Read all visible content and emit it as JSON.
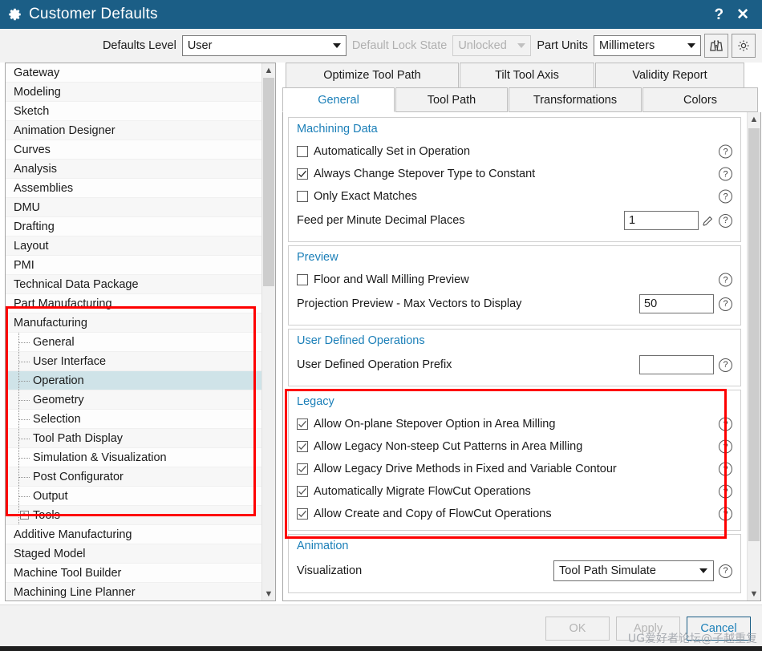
{
  "window": {
    "title": "Customer Defaults",
    "icon": "gear-icon",
    "help_button": "?",
    "close_button": "✕"
  },
  "toolbar": {
    "defaults_level_label": "Defaults Level",
    "defaults_level_value": "User",
    "lock_state_label": "Default Lock State",
    "lock_state_value": "Unlocked",
    "part_units_label": "Part Units",
    "part_units_value": "Millimeters",
    "find_icon": "binoculars-icon",
    "settings_icon": "gear-icon"
  },
  "sidebar": {
    "items": [
      {
        "label": "Gateway",
        "level": 0
      },
      {
        "label": "Modeling",
        "level": 0
      },
      {
        "label": "Sketch",
        "level": 0
      },
      {
        "label": "Animation Designer",
        "level": 0
      },
      {
        "label": "Curves",
        "level": 0
      },
      {
        "label": "Analysis",
        "level": 0
      },
      {
        "label": "Assemblies",
        "level": 0
      },
      {
        "label": "DMU",
        "level": 0
      },
      {
        "label": "Drafting",
        "level": 0
      },
      {
        "label": "Layout",
        "level": 0
      },
      {
        "label": "PMI",
        "level": 0
      },
      {
        "label": "Technical Data Package",
        "level": 0
      },
      {
        "label": "Part Manufacturing",
        "level": 0
      },
      {
        "label": "Manufacturing",
        "level": 0
      },
      {
        "label": "General",
        "level": 1
      },
      {
        "label": "User Interface",
        "level": 1
      },
      {
        "label": "Operation",
        "level": 1,
        "selected": true
      },
      {
        "label": "Geometry",
        "level": 1
      },
      {
        "label": "Selection",
        "level": 1
      },
      {
        "label": "Tool Path Display",
        "level": 1
      },
      {
        "label": "Simulation & Visualization",
        "level": 1
      },
      {
        "label": "Post Configurator",
        "level": 1
      },
      {
        "label": "Output",
        "level": 1
      },
      {
        "label": "Tools",
        "level": 1,
        "expandable": true,
        "expander": "+"
      },
      {
        "label": "Additive Manufacturing",
        "level": 0
      },
      {
        "label": "Staged Model",
        "level": 0
      },
      {
        "label": "Machine Tool Builder",
        "level": 0
      },
      {
        "label": "Machining Line Planner",
        "level": 0
      }
    ]
  },
  "tabs_top": [
    {
      "label": "Optimize Tool Path"
    },
    {
      "label": "Tilt Tool Axis"
    },
    {
      "label": "Validity Report"
    }
  ],
  "tabs_bottom": [
    {
      "label": "General",
      "active": true
    },
    {
      "label": "Tool Path"
    },
    {
      "label": "Transformations"
    },
    {
      "label": "Colors"
    }
  ],
  "panel": {
    "machining_data": {
      "title": "Machining Data",
      "rows": [
        {
          "label": "Automatically Set in Operation",
          "checked": false
        },
        {
          "label": "Always Change Stepover Type to Constant",
          "checked": true
        },
        {
          "label": "Only Exact Matches",
          "checked": false
        }
      ],
      "feed_label": "Feed per Minute Decimal Places",
      "feed_value": "1"
    },
    "preview": {
      "title": "Preview",
      "checkbox_label": "Floor and Wall Milling Preview",
      "checkbox_checked": false,
      "vectors_label": "Projection Preview - Max Vectors to Display",
      "vectors_value": "50"
    },
    "user_defined": {
      "title": "User Defined Operations",
      "prefix_label": "User Defined Operation Prefix",
      "prefix_value": ""
    },
    "legacy": {
      "title": "Legacy",
      "rows": [
        {
          "label": "Allow On-plane Stepover Option in Area Milling",
          "checked": true
        },
        {
          "label": "Allow Legacy Non-steep Cut Patterns in Area Milling",
          "checked": true
        },
        {
          "label": "Allow Legacy Drive Methods in Fixed and Variable Contour",
          "checked": true
        },
        {
          "label": "Automatically Migrate FlowCut Operations",
          "checked": true
        },
        {
          "label": "Allow Create and Copy of FlowCut Operations",
          "checked": true
        }
      ]
    },
    "animation": {
      "title": "Animation",
      "visualization_label": "Visualization",
      "visualization_value": "Tool Path Simulate"
    }
  },
  "footer": {
    "ok_label": "OK",
    "apply_label": "Apply",
    "cancel_label": "Cancel"
  },
  "watermark": "UG爱好者论坛@子越重复",
  "colors": {
    "titlebar": "#1b5e86",
    "accent": "#1b7fb8",
    "highlight_box": "#fe0000",
    "selection": "#cfe3e8"
  }
}
